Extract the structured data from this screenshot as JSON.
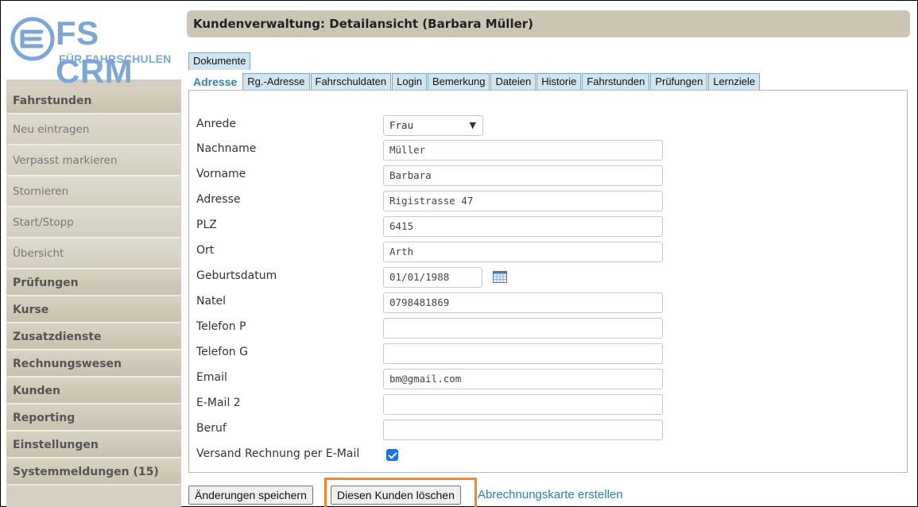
{
  "app": {
    "logo_title": "FS CRM",
    "logo_subtitle": "FÜR FAHRSCHULEN",
    "accent_color": "#2a7fbf",
    "highlight_color": "#f28a1d"
  },
  "sidebar": {
    "items": [
      {
        "label": "Fahrstunden",
        "type": "section"
      },
      {
        "label": "Neu eintragen",
        "type": "sub"
      },
      {
        "label": "Verpasst markieren",
        "type": "sub"
      },
      {
        "label": "Stornieren",
        "type": "sub"
      },
      {
        "label": "Start/Stopp",
        "type": "sub"
      },
      {
        "label": "Übersicht",
        "type": "sub"
      },
      {
        "label": "Prüfungen",
        "type": "section"
      },
      {
        "label": "Kurse",
        "type": "section"
      },
      {
        "label": "Zusatzdienste",
        "type": "section"
      },
      {
        "label": "Rechnungswesen",
        "type": "section"
      },
      {
        "label": "Kunden",
        "type": "section"
      },
      {
        "label": "Reporting",
        "type": "section"
      },
      {
        "label": "Einstellungen",
        "type": "section"
      },
      {
        "label": "Systemmeldungen (15)",
        "type": "section"
      }
    ]
  },
  "header": {
    "title": "Kundenverwaltung: Detailansicht (Barbara Müller)"
  },
  "tabs": {
    "row1": [
      "Dokumente"
    ],
    "row2": [
      "Adresse",
      "Rg.-Adresse",
      "Fahrschuldaten",
      "Login",
      "Bemerkung",
      "Dateien",
      "Historie",
      "Fahrstunden",
      "Prüfungen",
      "Lernziele"
    ],
    "active": "Adresse"
  },
  "form": {
    "anrede": {
      "label": "Anrede",
      "value": "Frau"
    },
    "nachname": {
      "label": "Nachname",
      "value": "Müller"
    },
    "vorname": {
      "label": "Vorname",
      "value": "Barbara"
    },
    "adresse": {
      "label": "Adresse",
      "value": "Rigistrasse 47"
    },
    "plz": {
      "label": "PLZ",
      "value": "6415"
    },
    "ort": {
      "label": "Ort",
      "value": "Arth"
    },
    "geburtsdatum": {
      "label": "Geburtsdatum",
      "value": "01/01/1988"
    },
    "natel": {
      "label": "Natel",
      "value": "0798481869"
    },
    "telefon_p": {
      "label": "Telefon P",
      "value": ""
    },
    "telefon_g": {
      "label": "Telefon G",
      "value": ""
    },
    "email": {
      "label": "Email",
      "value": "bm@gmail.com"
    },
    "email2": {
      "label": "E-Mail 2",
      "value": ""
    },
    "beruf": {
      "label": "Beruf",
      "value": ""
    },
    "versand": {
      "label": "Versand Rechnung per E-Mail",
      "checked": true
    }
  },
  "actions": {
    "save_label": "Änderungen speichern",
    "delete_label": "Diesen Kunden löschen",
    "card_label": "Abrechnungskarte erstellen"
  }
}
